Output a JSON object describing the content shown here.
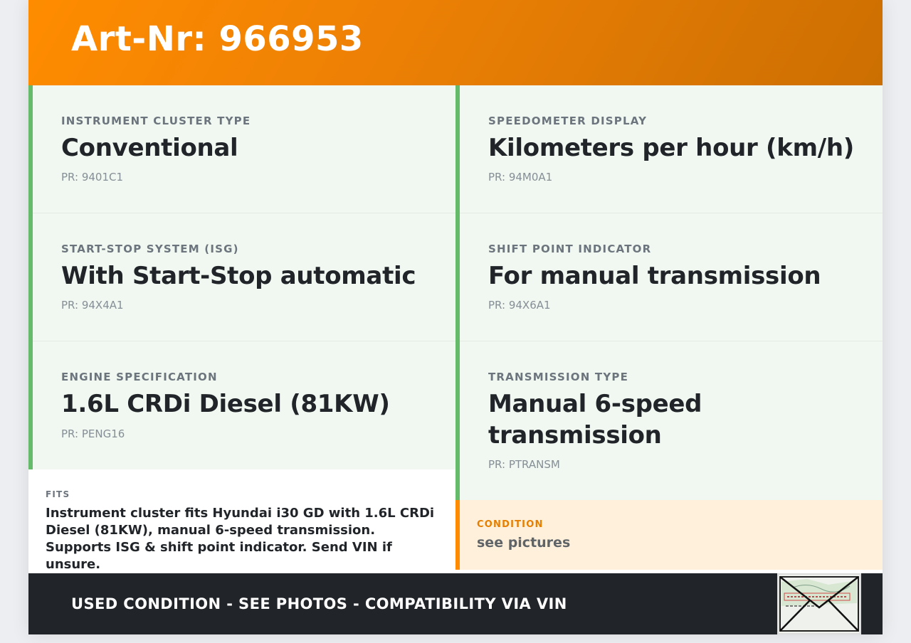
{
  "header": {
    "title": "Art-Nr: 966953"
  },
  "specs": [
    {
      "label": "INSTRUMENT CLUSTER TYPE",
      "value": "Conventional",
      "pr": "PR: 9401C1"
    },
    {
      "label": "SPEEDOMETER DISPLAY",
      "value": "Kilometers per hour (km/h)",
      "pr": "PR: 94M0A1"
    },
    {
      "label": "START-STOP SYSTEM (ISG)",
      "value": "With Start-Stop automatic",
      "pr": "PR: 94X4A1"
    },
    {
      "label": "SHIFT POINT INDICATOR",
      "value": "For manual transmission",
      "pr": "PR: 94X6A1"
    },
    {
      "label": "ENGINE SPECIFICATION",
      "value": "1.6L CRDi Diesel (81KW)",
      "pr": "PR: PENG16"
    },
    {
      "label": "TRANSMISSION TYPE",
      "value": "Manual 6-speed transmission",
      "pr": "PR: PTRANSM"
    }
  ],
  "fits": {
    "label": "FITS",
    "text": "Instrument cluster fits Hyundai i30 GD with 1.6L CRDi Diesel (81KW), manual 6-speed transmission. Supports ISG & shift point indicator. Send VIN if unsure."
  },
  "condition": {
    "label": "CONDITION",
    "text": "see pictures"
  },
  "footer": {
    "text": "USED CONDITION - SEE PHOTOS - COMPATIBILITY VIA VIN",
    "thumbnail": "vehicle-document-photo"
  },
  "colors": {
    "accent_orange": "#ff8c00",
    "accent_green": "#66bb6a",
    "spec_background": "#f1f8f1",
    "condition_background": "#fff0dc",
    "footer_background": "#212428"
  }
}
